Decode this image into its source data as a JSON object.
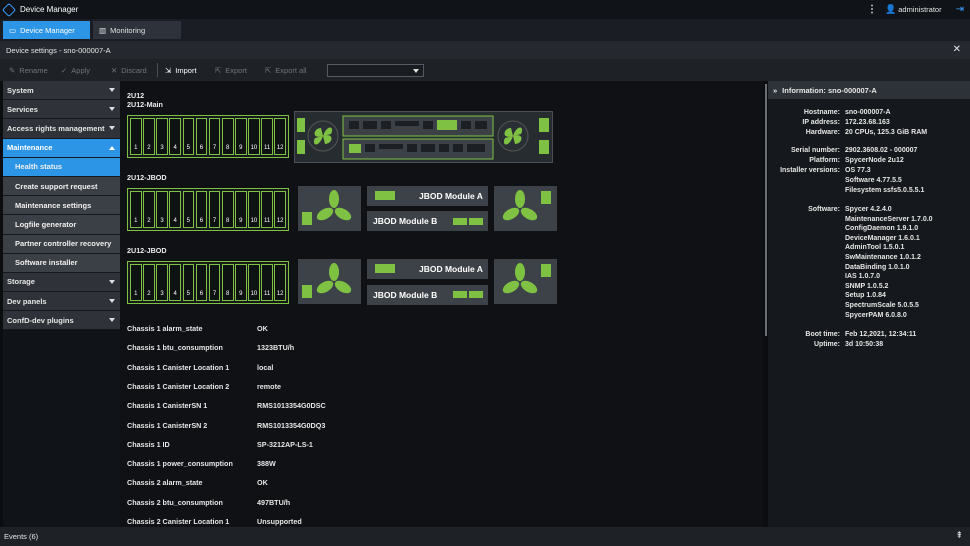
{
  "app": {
    "title": "Device Manager",
    "user": "administrator"
  },
  "tabs": [
    {
      "label": "Device Manager"
    },
    {
      "label": "Monitoring"
    }
  ],
  "settings_title": "Device settings - sno-000007-A",
  "toolbar": {
    "rename": "Rename",
    "apply": "Apply",
    "discard": "Discard",
    "import": "Import",
    "export": "Export",
    "export_all": "Export all"
  },
  "sidebar": {
    "system": "System",
    "services": "Services",
    "access": "Access rights management",
    "maintenance": "Maintenance",
    "sub": [
      "Health status",
      "Create support request",
      "Maintenance settings",
      "Logfile generator",
      "Partner controller recovery",
      "Software installer"
    ],
    "storage": "Storage",
    "dev_panels": "Dev panels",
    "confd": "ConfD-dev plugins"
  },
  "hardware": {
    "chassis1_type": "2U12",
    "chassis1_name": "2U12-Main",
    "jbod1_name": "2U12-JBOD",
    "jbod2_name": "2U12-JBOD",
    "module_a": "JBOD Module A",
    "module_b": "JBOD Module B",
    "bay_numbers": [
      "1",
      "2",
      "3",
      "4",
      "5",
      "6",
      "7",
      "8",
      "9",
      "10",
      "11",
      "12"
    ]
  },
  "properties": [
    {
      "k": "Chassis 1 alarm_state",
      "v": "OK"
    },
    {
      "k": "Chassis 1 btu_consumption",
      "v": "1323BTU/h"
    },
    {
      "k": "Chassis 1 Canister Location 1",
      "v": "local"
    },
    {
      "k": "Chassis 1 Canister Location 2",
      "v": "remote"
    },
    {
      "k": "Chassis 1 CanisterSN 1",
      "v": "RMS1013354G0DSC"
    },
    {
      "k": "Chassis 1 CanisterSN 2",
      "v": "RMS1013354G0DQ3"
    },
    {
      "k": "Chassis 1 ID",
      "v": "SP-3212AP-LS-1"
    },
    {
      "k": "Chassis 1 power_consumption",
      "v": "388W"
    },
    {
      "k": "Chassis 2 alarm_state",
      "v": "OK"
    },
    {
      "k": "Chassis 2 btu_consumption",
      "v": "497BTU/h"
    },
    {
      "k": "Chassis 2 Canister Location 1",
      "v": "Unsupported"
    }
  ],
  "info": {
    "title": "Information: sno-000007-A",
    "hostname_k": "Hostname:",
    "hostname": "sno-000007-A",
    "ip_k": "IP address:",
    "ip": "172.23.68.163",
    "hw_k": "Hardware:",
    "hw": "20 CPUs, 125.3 GiB RAM",
    "serial_k": "Serial number:",
    "serial": "2902.3608.02 - 000007",
    "platform_k": "Platform:",
    "platform": "SpycerNode 2u12",
    "installer_k": "Installer versions:",
    "installer": [
      "OS 77.3",
      "Software 4.77.5.5",
      "Filesystem ssfs5.0.5.5.1"
    ],
    "software_k": "Software:",
    "software": [
      "Spycer 4.2.4.0",
      "MaintenanceServer 1.7.0.0",
      "ConfigDaemon 1.9.1.0",
      "DeviceManager 1.6.0.1",
      "AdminTool 1.5.0.1",
      "SwMaintenance 1.0.1.2",
      "DataBinding 1.0.1.0",
      "IAS 1.0.7.0",
      "SNMP 1.0.5.2",
      "Setup 1.0.84",
      "SpectrumScale 5.0.5.5",
      "SpycerPAM 6.0.8.0"
    ],
    "boot_k": "Boot time:",
    "boot": "Feb 12,2021, 12:34:11",
    "uptime_k": "Uptime:",
    "uptime": "3d 10:50:38"
  },
  "events": "Events (6)",
  "colors": {
    "accent": "#2d95e6",
    "ok_green": "#7fc142"
  }
}
